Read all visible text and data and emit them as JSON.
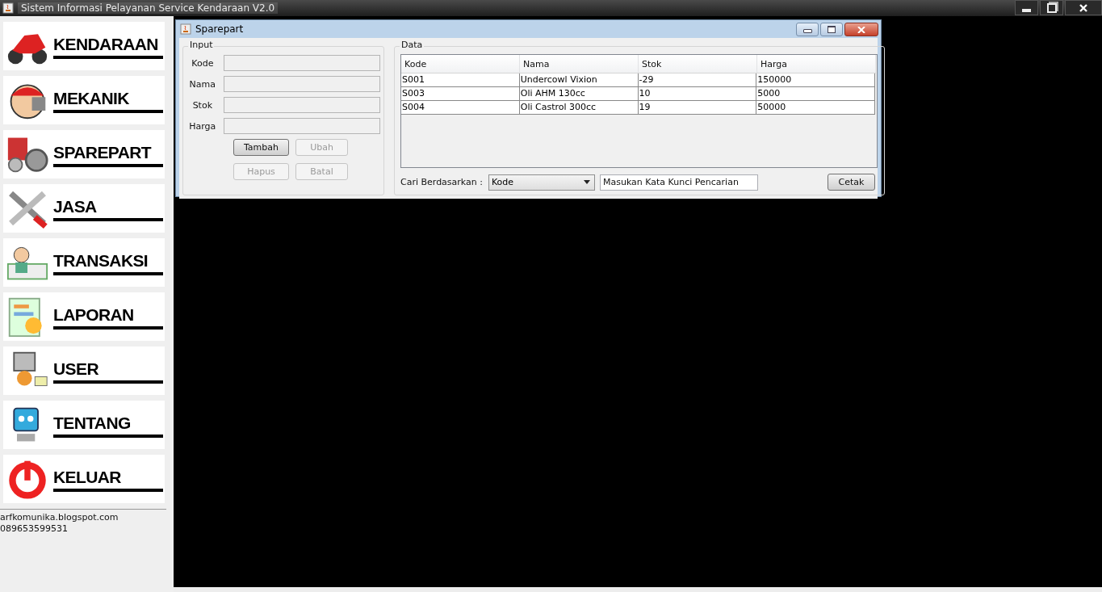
{
  "window": {
    "title": "Sistem Informasi Pelayanan Service Kendaraan V2.0"
  },
  "sidebar": {
    "items": [
      {
        "label": "KENDARAAN"
      },
      {
        "label": "MEKANIK"
      },
      {
        "label": "SPAREPART"
      },
      {
        "label": "JASA"
      },
      {
        "label": "TRANSAKSI"
      },
      {
        "label": "LAPORAN"
      },
      {
        "label": "USER"
      },
      {
        "label": "TENTANG"
      },
      {
        "label": "KELUAR"
      }
    ],
    "footer": [
      "arfkomunika.blogspot.com",
      "089653599531"
    ]
  },
  "inner_window": {
    "title": "Sparepart",
    "input": {
      "legend": "Input",
      "fields": [
        {
          "label": "Kode",
          "disabled": true
        },
        {
          "label": "Nama",
          "disabled": true
        },
        {
          "label": "Stok",
          "disabled": true
        },
        {
          "label": "Harga",
          "disabled": true
        }
      ],
      "buttons": [
        {
          "label": "Tambah",
          "disabled": false
        },
        {
          "label": "Ubah",
          "disabled": true
        },
        {
          "label": "Hapus",
          "disabled": true
        },
        {
          "label": "Batal",
          "disabled": true
        }
      ]
    },
    "data": {
      "legend": "Data",
      "table": {
        "columns": [
          "Kode",
          "Nama",
          "Stok",
          "Harga"
        ],
        "rows": [
          [
            "S001",
            "Undercowl Vixion",
            "-29",
            "150000"
          ],
          [
            "S003",
            "Oli AHM 130cc",
            "10",
            "5000"
          ],
          [
            "S004",
            "Oli Castrol 300cc",
            "19",
            "50000"
          ]
        ]
      },
      "search_label": "Cari Berdasarkan :",
      "search_by": "Kode",
      "search_value": "Masukan Kata Kunci Pencarian",
      "print_button": "Cetak"
    }
  }
}
